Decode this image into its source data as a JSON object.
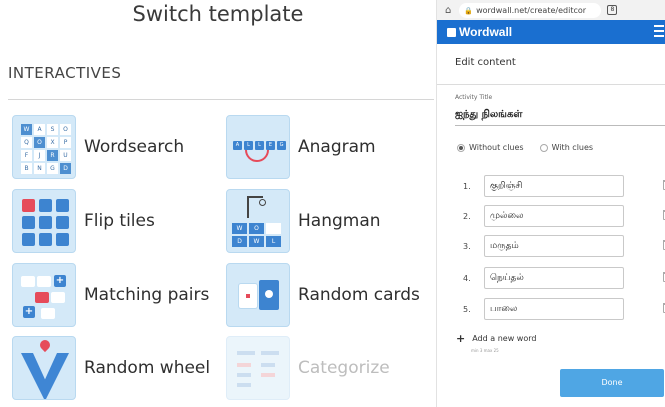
{
  "left_panel": {
    "title": "Switch template",
    "section": "INTERACTIVES",
    "templates": [
      {
        "label": "Wordsearch"
      },
      {
        "label": "Anagram"
      },
      {
        "label": "Flip tiles"
      },
      {
        "label": "Hangman"
      },
      {
        "label": "Matching pairs"
      },
      {
        "label": "Random cards"
      },
      {
        "label": "Random wheel"
      },
      {
        "label": "Categorize",
        "disabled": true
      }
    ],
    "thumb_letters": {
      "wordsearch": [
        "W",
        "A",
        "S",
        "O",
        "Q",
        "O",
        "X",
        "P",
        "F",
        "J",
        "R",
        "U",
        "B",
        "N",
        "G",
        "D"
      ],
      "anagram": [
        "A",
        "L",
        "L",
        "E",
        "G"
      ],
      "hangman": [
        "W",
        "O",
        "",
        "D",
        "W",
        "L",
        "L",
        ""
      ]
    }
  },
  "browser": {
    "url": "wordwall.net/create/editcor",
    "tab_count": "8"
  },
  "editor": {
    "brand": "Wordwall",
    "heading": "Edit content",
    "activity_title_label": "Activity Title",
    "activity_title": "ஐந்து நிலங்கள்",
    "radio_without": "Without clues",
    "radio_with": "With clues",
    "items": [
      {
        "num": "1.",
        "value": "குறிஞ்சி"
      },
      {
        "num": "2.",
        "value": "முல்லை"
      },
      {
        "num": "3.",
        "value": "மருதம்"
      },
      {
        "num": "4.",
        "value": "நெய்தல்"
      },
      {
        "num": "5.",
        "value": "பாலை"
      }
    ],
    "add_word": "Add a new word",
    "min_max": "min 3   max 25",
    "done": "Done"
  },
  "colors": {
    "brand_blue": "#1a6fd0",
    "thumb_bg": "#d4e9f8",
    "accent_red": "#e64b5a",
    "done_blue": "#4fa6e4"
  }
}
